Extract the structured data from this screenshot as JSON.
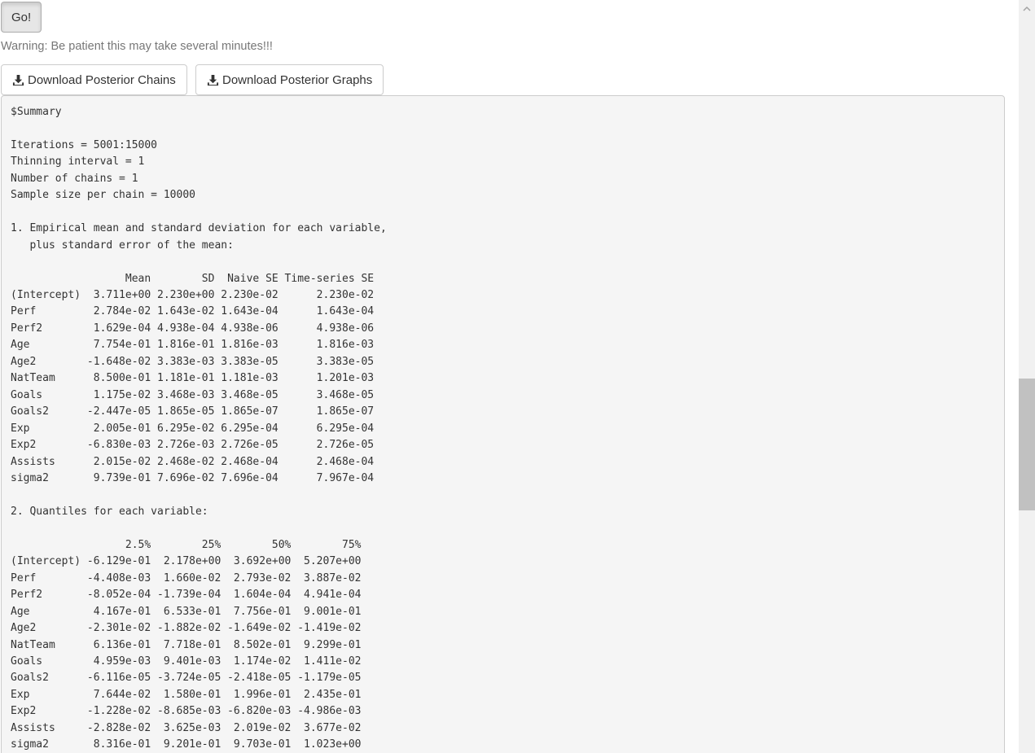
{
  "go_button": {
    "label": "Go!"
  },
  "warning": "Warning: Be patient this may take several minutes!!!",
  "downloads": {
    "chains_label": "Download Posterior Chains",
    "graphs_label": "Download Posterior Graphs",
    "icon": "download-icon"
  },
  "output": {
    "text": "$Summary\n\nIterations = 5001:15000\nThinning interval = 1 \nNumber of chains = 1 \nSample size per chain = 10000 \n\n1. Empirical mean and standard deviation for each variable,\n   plus standard error of the mean:\n\n                  Mean        SD  Naive SE Time-series SE\n(Intercept)  3.711e+00 2.230e+00 2.230e-02      2.230e-02\nPerf         2.784e-02 1.643e-02 1.643e-04      1.643e-04\nPerf2        1.629e-04 4.938e-04 4.938e-06      4.938e-06\nAge          7.754e-01 1.816e-01 1.816e-03      1.816e-03\nAge2        -1.648e-02 3.383e-03 3.383e-05      3.383e-05\nNatTeam      8.500e-01 1.181e-01 1.181e-03      1.201e-03\nGoals        1.175e-02 3.468e-03 3.468e-05      3.468e-05\nGoals2      -2.447e-05 1.865e-05 1.865e-07      1.865e-07\nExp          2.005e-01 6.295e-02 6.295e-04      6.295e-04\nExp2        -6.830e-03 2.726e-03 2.726e-05      2.726e-05\nAssists      2.015e-02 2.468e-02 2.468e-04      2.468e-04\nsigma2       9.739e-01 7.696e-02 7.696e-04      7.967e-04\n\n2. Quantiles for each variable:\n\n                  2.5%        25%        50%        75%\n(Intercept) -6.129e-01  2.178e+00  3.692e+00  5.207e+00\nPerf        -4.408e-03  1.660e-02  2.793e-02  3.887e-02\nPerf2       -8.052e-04 -1.739e-04  1.604e-04  4.941e-04\nAge          4.167e-01  6.533e-01  7.756e-01  9.001e-01\nAge2        -2.301e-02 -1.882e-02 -1.649e-02 -1.419e-02\nNatTeam      6.136e-01  7.718e-01  8.502e-01  9.299e-01\nGoals        4.959e-03  9.401e-03  1.174e-02  1.411e-02\nGoals2      -6.116e-05 -3.724e-05 -2.418e-05 -1.179e-05\nExp          7.644e-02  1.580e-01  1.996e-01  2.435e-01\nExp2        -1.228e-02 -8.685e-03 -6.820e-03 -4.986e-03\nAssists     -2.828e-02  3.625e-03  2.019e-02  3.677e-02\nsigma2       8.316e-01  9.201e-01  9.703e-01  1.023e+00"
  },
  "scrollbar": {
    "up_icon": "chevron-up-icon"
  }
}
